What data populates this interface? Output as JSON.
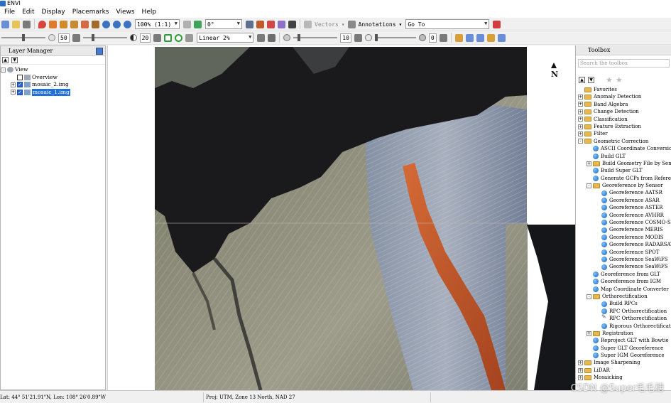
{
  "window": {
    "title": "ENVI"
  },
  "menubar": {
    "items": [
      "File",
      "Edit",
      "Display",
      "Placemarks",
      "Views",
      "Help"
    ]
  },
  "toolbar1": {
    "zoom_value": "100% (1:1)",
    "rotation_value": "0°",
    "vectors_label": "Vectors",
    "annotations_label": "Annotations",
    "goto_value": "Go To"
  },
  "toolbar2": {
    "brightness_value": "50",
    "contrast_value": "20",
    "stretch_value": "Linear 2%",
    "sharpen_value": "10",
    "transparency_value": "0",
    "brightness_level": 0.5,
    "contrast_level": 0.2,
    "sharpen_level": 0.1,
    "transparency_level": 0.0
  },
  "layer_manager": {
    "title": "Layer Manager",
    "root": "View",
    "items": [
      {
        "label": "Overview",
        "checked": false,
        "selected": false,
        "expander": ""
      },
      {
        "label": "mosaic_2.img",
        "checked": true,
        "selected": false,
        "expander": "+"
      },
      {
        "label": "mosaic_1.img",
        "checked": true,
        "selected": true,
        "expander": "+"
      }
    ]
  },
  "viewer": {
    "north_label": "N"
  },
  "toolbox": {
    "title": "Toolbox",
    "search_placeholder": "Search the toolbox",
    "tree": [
      {
        "label": "Favorites",
        "level": 0,
        "kind": "folder",
        "expander": ""
      },
      {
        "label": "Anomaly Detection",
        "level": 0,
        "kind": "folder",
        "expander": "+"
      },
      {
        "label": "Band Algebra",
        "level": 0,
        "kind": "folder",
        "expander": "+"
      },
      {
        "label": "Change Detection",
        "level": 0,
        "kind": "folder",
        "expander": "+"
      },
      {
        "label": "Classification",
        "level": 0,
        "kind": "folder",
        "expander": "+"
      },
      {
        "label": "Feature Extraction",
        "level": 0,
        "kind": "folder",
        "expander": "+"
      },
      {
        "label": "Filter",
        "level": 0,
        "kind": "folder",
        "expander": "+"
      },
      {
        "label": "Geometric Correction",
        "level": 0,
        "kind": "folder",
        "expander": "-"
      },
      {
        "label": "ASCII Coordinate Conversion",
        "level": 1,
        "kind": "tool",
        "expander": ""
      },
      {
        "label": "Build GLT",
        "level": 1,
        "kind": "tool",
        "expander": ""
      },
      {
        "label": "Build Geometry File by Sensor",
        "level": 1,
        "kind": "folder",
        "expander": "+"
      },
      {
        "label": "Build Super GLT",
        "level": 1,
        "kind": "tool",
        "expander": ""
      },
      {
        "label": "Generate GCPs from Reference Image",
        "level": 1,
        "kind": "tool",
        "expander": ""
      },
      {
        "label": "Georeference by Sensor",
        "level": 1,
        "kind": "folder",
        "expander": "-"
      },
      {
        "label": "Georeference AATSR",
        "level": 2,
        "kind": "tool",
        "expander": ""
      },
      {
        "label": "Georeference ASAR",
        "level": 2,
        "kind": "tool",
        "expander": ""
      },
      {
        "label": "Georeference ASTER",
        "level": 2,
        "kind": "tool",
        "expander": ""
      },
      {
        "label": "Georeference AVHRR",
        "level": 2,
        "kind": "tool",
        "expander": ""
      },
      {
        "label": "Georeference COSMO-SkyMed",
        "level": 2,
        "kind": "tool",
        "expander": ""
      },
      {
        "label": "Georeference MERIS",
        "level": 2,
        "kind": "tool",
        "expander": ""
      },
      {
        "label": "Georeference MODIS",
        "level": 2,
        "kind": "tool",
        "expander": ""
      },
      {
        "label": "Georeference RADARSAT",
        "level": 2,
        "kind": "tool",
        "expander": ""
      },
      {
        "label": "Georeference SPOT",
        "level": 2,
        "kind": "tool",
        "expander": ""
      },
      {
        "label": "Georeference SeaWiFS",
        "level": 2,
        "kind": "tool",
        "expander": ""
      },
      {
        "label": "Georeference SeaWiFS",
        "level": 2,
        "kind": "tool",
        "expander": ""
      },
      {
        "label": "Georeference from GLT",
        "level": 1,
        "kind": "tool",
        "expander": ""
      },
      {
        "label": "Georeference from IGM",
        "level": 1,
        "kind": "tool",
        "expander": ""
      },
      {
        "label": "Map Coordinate Converter",
        "level": 1,
        "kind": "tool",
        "expander": ""
      },
      {
        "label": "Orthorectification",
        "level": 1,
        "kind": "folder",
        "expander": "-"
      },
      {
        "label": "Build RPCs",
        "level": 2,
        "kind": "tool",
        "expander": ""
      },
      {
        "label": "RPC Orthorectification",
        "level": 2,
        "kind": "tool",
        "expander": ""
      },
      {
        "label": "RPC Orthorectification",
        "level": 2,
        "kind": "pen",
        "expander": ""
      },
      {
        "label": "Rigorous Orthorectification",
        "level": 2,
        "kind": "tool",
        "expander": ""
      },
      {
        "label": "Registration",
        "level": 1,
        "kind": "folder",
        "expander": "+"
      },
      {
        "label": "Reproject GLT with Bowtie",
        "level": 1,
        "kind": "tool",
        "expander": ""
      },
      {
        "label": "Super GLT Georeference",
        "level": 1,
        "kind": "tool",
        "expander": ""
      },
      {
        "label": "Super IGM Georeference",
        "level": 1,
        "kind": "tool",
        "expander": ""
      },
      {
        "label": "Image Sharpening",
        "level": 0,
        "kind": "folder",
        "expander": "+"
      },
      {
        "label": "LiDAR",
        "level": 0,
        "kind": "folder",
        "expander": "+"
      },
      {
        "label": "Mosaicking",
        "level": 0,
        "kind": "folder",
        "expander": "+"
      }
    ]
  },
  "statusbar": {
    "coords": "Lat: 44° 51'21.91\"N, Lon: 108° 26'0.89\"W",
    "projection": "Proj: UTM, Zone 13 North, NAD 27"
  },
  "watermark": "CSDN @Super毛毛穗",
  "colors": {
    "accent": "#1f6fd6",
    "folder": "#e6b84d",
    "terrain_red": "#c4582a"
  }
}
